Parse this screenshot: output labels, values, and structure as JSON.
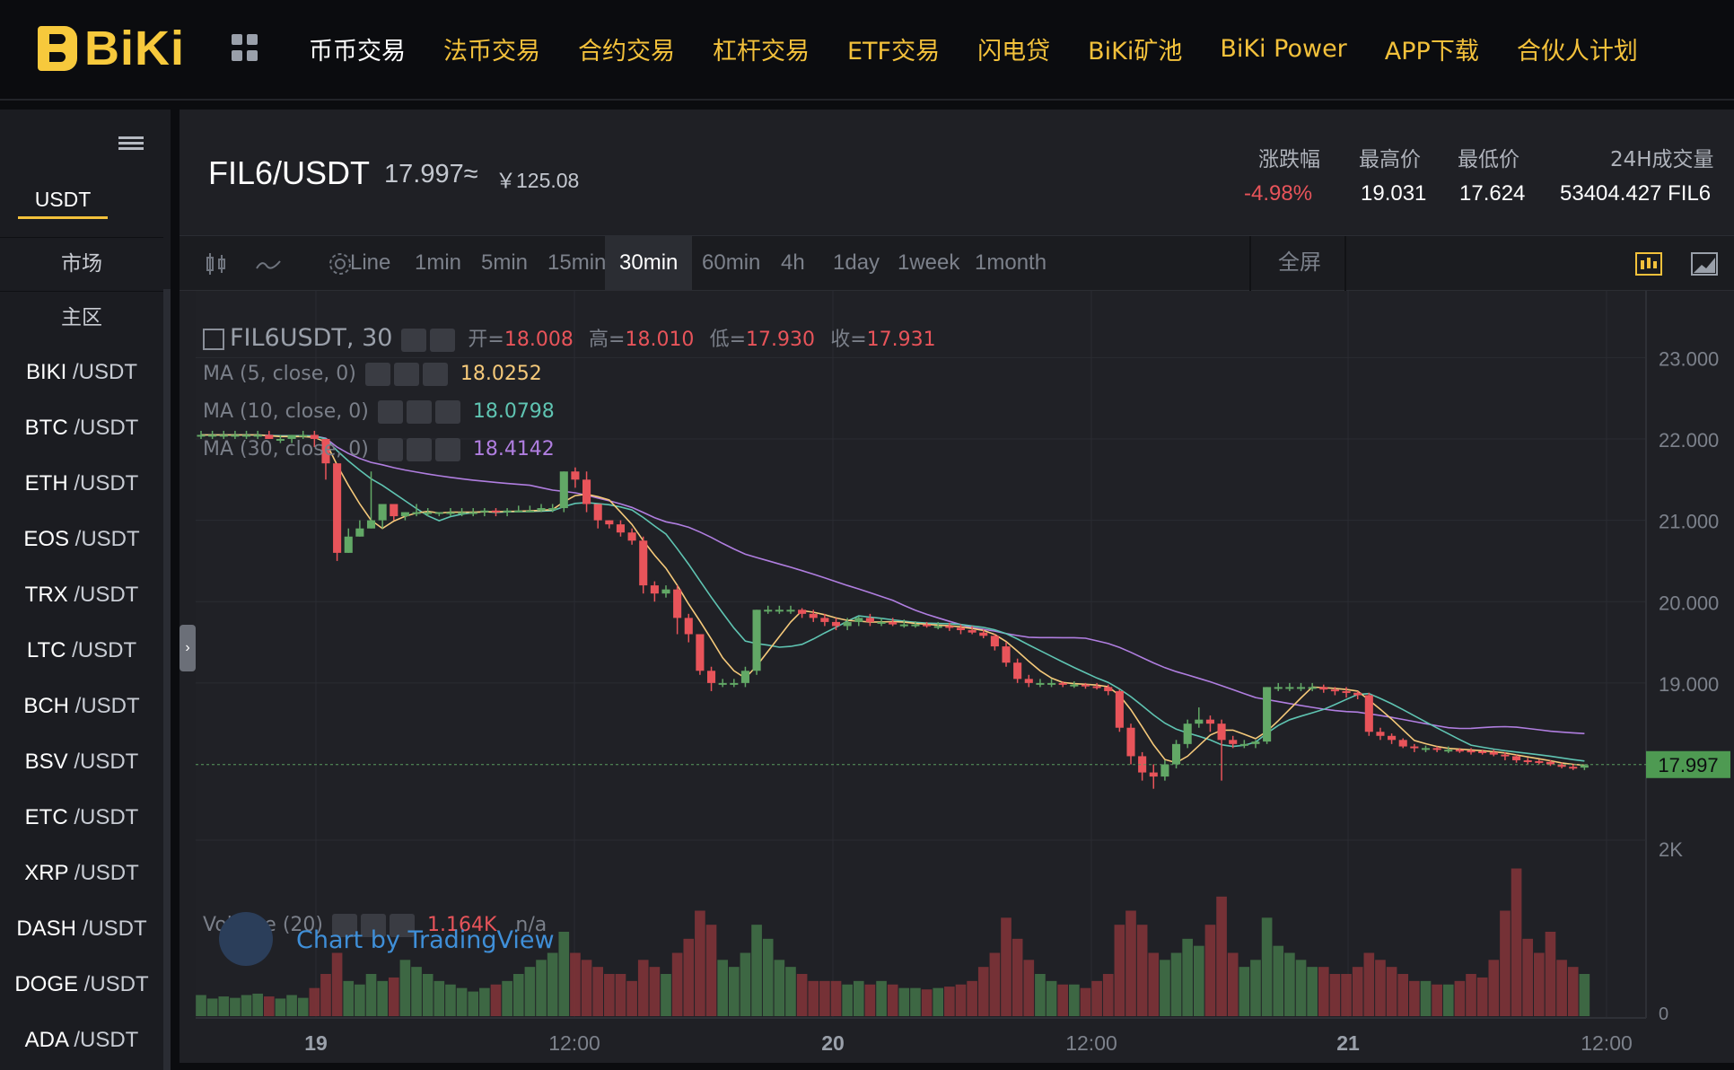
{
  "brand": {
    "name": "BiKi"
  },
  "nav": [
    "币币交易",
    "法币交易",
    "合约交易",
    "杠杆交易",
    "ETF交易",
    "闪电贷",
    "BiKi矿池",
    "BiKi Power",
    "APP下载",
    "合伙人计划"
  ],
  "sidebar": {
    "quote_tab": "USDT",
    "market_label": "市场",
    "zone_label": "主区",
    "pairs": [
      {
        "base": "BIKI",
        "quote": "/USDT"
      },
      {
        "base": "BTC",
        "quote": "/USDT"
      },
      {
        "base": "ETH",
        "quote": "/USDT"
      },
      {
        "base": "EOS",
        "quote": "/USDT"
      },
      {
        "base": "TRX",
        "quote": "/USDT"
      },
      {
        "base": "LTC",
        "quote": "/USDT"
      },
      {
        "base": "BCH",
        "quote": "/USDT"
      },
      {
        "base": "BSV",
        "quote": "/USDT"
      },
      {
        "base": "ETC",
        "quote": "/USDT"
      },
      {
        "base": "XRP",
        "quote": "/USDT"
      },
      {
        "base": "DASH",
        "quote": "/USDT"
      },
      {
        "base": "DOGE",
        "quote": "/USDT"
      },
      {
        "base": "ADA",
        "quote": "/USDT"
      }
    ]
  },
  "header": {
    "pair": "FIL6/USDT",
    "price": "17.997≈",
    "price_cny": "￥125.08",
    "stats": {
      "change_label": "涨跌幅",
      "change_value": "-4.98%",
      "high_label": "最高价",
      "high_value": "19.031",
      "low_label": "最低价",
      "low_value": "17.624",
      "volume_label": "24H成交量",
      "volume_value": "53404.427 FIL6"
    }
  },
  "toolbar": {
    "intervals": [
      "Line",
      "1min",
      "5min",
      "15min",
      "30min",
      "60min",
      "4h",
      "1day",
      "1week",
      "1month"
    ],
    "active_interval": "30min",
    "fullscreen_label": "全屏"
  },
  "chart_legend": {
    "symbol": "FIL6USDT, 30",
    "open_label": "开=",
    "open_value": "18.008",
    "high_label": "高=",
    "high_value": "18.010",
    "low_label": "低=",
    "low_value": "17.930",
    "close_label": "收=",
    "close_value": "17.931",
    "ma5_label": "MA (5, close, 0)",
    "ma5_value": "18.0252",
    "ma10_label": "MA (10, close, 0)",
    "ma10_value": "18.0798",
    "ma30_label": "MA (30, close, 0)",
    "ma30_value": "18.4142",
    "volume_label": "Volume (20)",
    "volume_value": "1.164K",
    "volume_na": "n/a",
    "tv_label": "Chart by TradingView"
  },
  "colors": {
    "up": "#5a9b5e",
    "down": "#e8545a",
    "ma5": "#f5c97a",
    "ma10": "#5fc4b2",
    "ma30": "#b07ee0",
    "brand": "#f3c13b"
  },
  "chart_data": {
    "type": "candlestick",
    "y_ticks": [
      "23.000",
      "22.000",
      "21.000",
      "20.000",
      "19.000"
    ],
    "last_price": "17.997",
    "volume_ticks": [
      "2K",
      "0"
    ],
    "x_ticks": [
      "19",
      "12:00",
      "20",
      "12:00",
      "21",
      "12:00"
    ],
    "ylim": [
      17.2,
      23.6
    ],
    "volume_max": 2400,
    "candles": [
      [
        22.05,
        22.1,
        22.0,
        22.05,
        300
      ],
      [
        22.05,
        22.1,
        22.0,
        22.05,
        250
      ],
      [
        22.05,
        22.1,
        22.0,
        22.05,
        280
      ],
      [
        22.05,
        22.1,
        22.0,
        22.05,
        260
      ],
      [
        22.05,
        22.1,
        22.0,
        22.05,
        300
      ],
      [
        22.05,
        22.1,
        22.0,
        22.05,
        320
      ],
      [
        22.05,
        22.1,
        22.0,
        22.0,
        280
      ],
      [
        22.0,
        22.05,
        21.95,
        22.0,
        250
      ],
      [
        22.0,
        22.05,
        21.95,
        22.05,
        300
      ],
      [
        22.05,
        22.1,
        22.0,
        22.05,
        260
      ],
      [
        22.05,
        22.1,
        21.9,
        22.0,
        400
      ],
      [
        22.0,
        22.0,
        21.5,
        21.7,
        600
      ],
      [
        21.7,
        21.7,
        20.5,
        20.6,
        900
      ],
      [
        20.6,
        20.9,
        20.6,
        20.8,
        500
      ],
      [
        20.8,
        21.0,
        20.8,
        20.9,
        450
      ],
      [
        20.9,
        21.6,
        20.9,
        21.0,
        600
      ],
      [
        21.0,
        21.2,
        20.9,
        21.2,
        500
      ],
      [
        21.2,
        21.2,
        21.0,
        21.05,
        550
      ],
      [
        21.05,
        21.1,
        21.0,
        21.1,
        800
      ],
      [
        21.1,
        21.2,
        21.05,
        21.1,
        700
      ],
      [
        21.1,
        21.15,
        21.05,
        21.1,
        600
      ],
      [
        21.1,
        21.1,
        21.05,
        21.1,
        500
      ],
      [
        21.1,
        21.15,
        21.05,
        21.1,
        450
      ],
      [
        21.1,
        21.15,
        21.05,
        21.1,
        400
      ],
      [
        21.1,
        21.15,
        21.05,
        21.1,
        350
      ],
      [
        21.1,
        21.15,
        21.05,
        21.12,
        400
      ],
      [
        21.12,
        21.15,
        21.05,
        21.1,
        450
      ],
      [
        21.1,
        21.15,
        21.05,
        21.12,
        500
      ],
      [
        21.12,
        21.18,
        21.1,
        21.12,
        600
      ],
      [
        21.12,
        21.18,
        21.1,
        21.12,
        700
      ],
      [
        21.12,
        21.2,
        21.1,
        21.15,
        800
      ],
      [
        21.15,
        21.2,
        21.1,
        21.15,
        900
      ],
      [
        21.15,
        21.6,
        21.1,
        21.6,
        1200
      ],
      [
        21.6,
        21.65,
        21.4,
        21.5,
        900
      ],
      [
        21.5,
        21.6,
        21.1,
        21.2,
        800
      ],
      [
        21.2,
        21.2,
        20.9,
        21.0,
        700
      ],
      [
        21.0,
        21.0,
        20.9,
        20.95,
        600
      ],
      [
        20.95,
        21.0,
        20.8,
        20.85,
        600
      ],
      [
        20.85,
        20.9,
        20.7,
        20.75,
        500
      ],
      [
        20.75,
        20.8,
        20.1,
        20.2,
        800
      ],
      [
        20.2,
        20.25,
        20.0,
        20.1,
        700
      ],
      [
        20.1,
        20.2,
        20.05,
        20.15,
        600
      ],
      [
        20.15,
        20.2,
        19.6,
        19.8,
        900
      ],
      [
        19.8,
        19.85,
        19.5,
        19.6,
        1100
      ],
      [
        19.6,
        19.6,
        19.1,
        19.15,
        1500
      ],
      [
        19.15,
        19.2,
        18.9,
        19.0,
        1300
      ],
      [
        19.0,
        19.05,
        18.95,
        19.0,
        800
      ],
      [
        19.0,
        19.05,
        18.95,
        19.0,
        700
      ],
      [
        19.0,
        19.2,
        18.95,
        19.15,
        900
      ],
      [
        19.15,
        19.9,
        19.1,
        19.9,
        1300
      ],
      [
        19.9,
        19.95,
        19.85,
        19.9,
        1100
      ],
      [
        19.9,
        19.95,
        19.85,
        19.9,
        800
      ],
      [
        19.9,
        19.95,
        19.85,
        19.9,
        700
      ],
      [
        19.9,
        19.92,
        19.8,
        19.85,
        600
      ],
      [
        19.85,
        19.9,
        19.75,
        19.8,
        500
      ],
      [
        19.8,
        19.85,
        19.7,
        19.75,
        500
      ],
      [
        19.75,
        19.8,
        19.65,
        19.7,
        500
      ],
      [
        19.7,
        19.8,
        19.65,
        19.75,
        450
      ],
      [
        19.75,
        19.82,
        19.7,
        19.8,
        500
      ],
      [
        19.8,
        19.85,
        19.7,
        19.75,
        450
      ],
      [
        19.75,
        19.8,
        19.7,
        19.75,
        500
      ],
      [
        19.75,
        19.8,
        19.7,
        19.72,
        450
      ],
      [
        19.72,
        19.78,
        19.68,
        19.72,
        400
      ],
      [
        19.72,
        19.76,
        19.68,
        19.72,
        400
      ],
      [
        19.72,
        19.75,
        19.68,
        19.7,
        380
      ],
      [
        19.7,
        19.75,
        19.66,
        19.7,
        400
      ],
      [
        19.7,
        19.74,
        19.64,
        19.68,
        420
      ],
      [
        19.68,
        19.72,
        19.6,
        19.65,
        450
      ],
      [
        19.65,
        19.7,
        19.6,
        19.62,
        500
      ],
      [
        19.62,
        19.66,
        19.55,
        19.58,
        700
      ],
      [
        19.58,
        19.6,
        19.4,
        19.45,
        900
      ],
      [
        19.45,
        19.5,
        19.2,
        19.25,
        1400
      ],
      [
        19.25,
        19.3,
        19.0,
        19.05,
        1100
      ],
      [
        19.05,
        19.1,
        18.95,
        19.0,
        800
      ],
      [
        19.0,
        19.05,
        18.95,
        19.0,
        600
      ],
      [
        19.0,
        19.05,
        18.95,
        19.0,
        500
      ],
      [
        19.0,
        19.02,
        18.95,
        18.98,
        450
      ],
      [
        18.98,
        19.02,
        18.94,
        18.98,
        450
      ],
      [
        18.98,
        19.0,
        18.93,
        18.96,
        400
      ],
      [
        18.96,
        19.0,
        18.92,
        18.95,
        500
      ],
      [
        18.95,
        18.98,
        18.85,
        18.9,
        600
      ],
      [
        18.9,
        18.92,
        18.4,
        18.45,
        1300
      ],
      [
        18.45,
        18.5,
        18.0,
        18.1,
        1500
      ],
      [
        18.1,
        18.15,
        17.8,
        17.9,
        1300
      ],
      [
        17.9,
        18.0,
        17.7,
        17.85,
        900
      ],
      [
        17.85,
        18.05,
        17.8,
        18.0,
        800
      ],
      [
        18.0,
        18.3,
        17.95,
        18.25,
        900
      ],
      [
        18.25,
        18.55,
        18.2,
        18.5,
        1100
      ],
      [
        18.5,
        18.7,
        18.45,
        18.55,
        1000
      ],
      [
        18.55,
        18.6,
        18.4,
        18.5,
        1300
      ],
      [
        18.5,
        18.55,
        17.8,
        18.3,
        1700
      ],
      [
        18.3,
        18.35,
        18.2,
        18.25,
        900
      ],
      [
        18.25,
        18.3,
        18.2,
        18.25,
        700
      ],
      [
        18.25,
        18.3,
        18.2,
        18.28,
        800
      ],
      [
        18.28,
        18.95,
        18.25,
        18.95,
        1400
      ],
      [
        18.95,
        19.0,
        18.9,
        18.95,
        1000
      ],
      [
        18.95,
        19.0,
        18.9,
        18.95,
        900
      ],
      [
        18.95,
        19.0,
        18.9,
        18.95,
        800
      ],
      [
        18.95,
        19.0,
        18.9,
        18.95,
        700
      ],
      [
        18.95,
        18.98,
        18.88,
        18.92,
        700
      ],
      [
        18.92,
        18.95,
        18.85,
        18.9,
        600
      ],
      [
        18.9,
        18.95,
        18.82,
        18.88,
        600
      ],
      [
        18.88,
        18.9,
        18.8,
        18.85,
        700
      ],
      [
        18.85,
        18.88,
        18.35,
        18.4,
        900
      ],
      [
        18.4,
        18.45,
        18.3,
        18.35,
        800
      ],
      [
        18.35,
        18.38,
        18.25,
        18.3,
        700
      ],
      [
        18.3,
        18.32,
        18.2,
        18.22,
        600
      ],
      [
        18.22,
        18.25,
        18.15,
        18.2,
        500
      ],
      [
        18.2,
        18.23,
        18.15,
        18.2,
        500
      ],
      [
        18.2,
        18.22,
        18.15,
        18.18,
        450
      ],
      [
        18.18,
        18.22,
        18.14,
        18.18,
        450
      ],
      [
        18.18,
        18.2,
        18.14,
        18.17,
        500
      ],
      [
        18.17,
        18.2,
        18.12,
        18.16,
        600
      ],
      [
        18.16,
        18.18,
        18.12,
        18.15,
        550
      ],
      [
        18.15,
        18.18,
        18.1,
        18.12,
        800
      ],
      [
        18.12,
        18.15,
        18.05,
        18.1,
        1500
      ],
      [
        18.1,
        18.12,
        18.02,
        18.05,
        2100
      ],
      [
        18.05,
        18.08,
        18.0,
        18.04,
        1100
      ],
      [
        18.04,
        18.06,
        18.0,
        18.03,
        900
      ],
      [
        18.03,
        18.05,
        17.98,
        18.0,
        1200
      ],
      [
        18.0,
        18.02,
        17.95,
        17.97,
        800
      ],
      [
        17.97,
        18.0,
        17.93,
        17.96,
        700
      ],
      [
        17.96,
        18.0,
        17.93,
        17.99,
        600
      ]
    ]
  }
}
